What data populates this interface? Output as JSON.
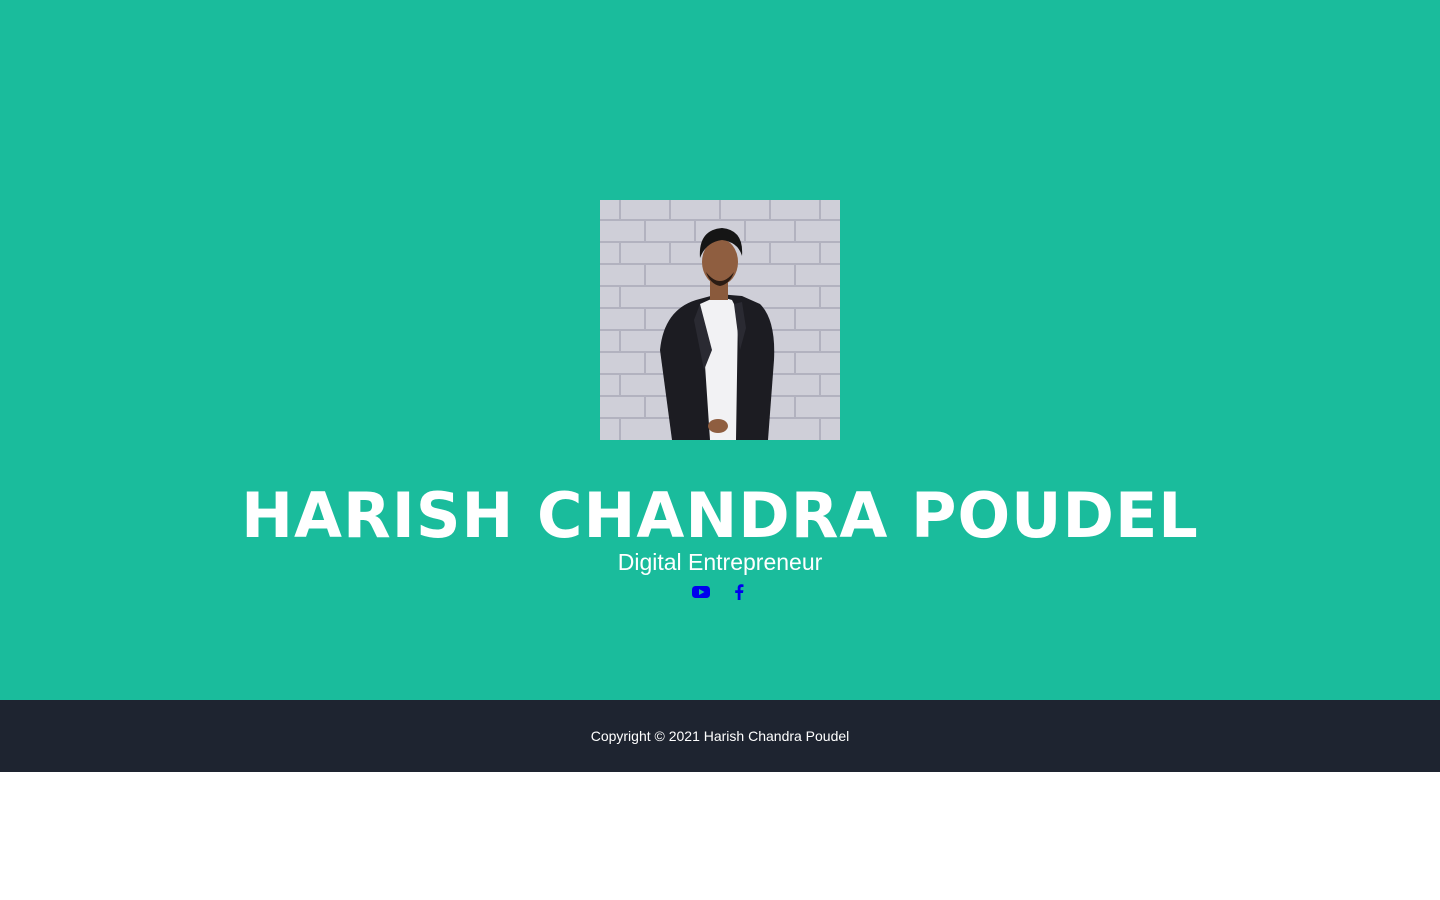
{
  "colors": {
    "hero_background": "#1abc9c",
    "footer_background": "#1e2430",
    "text": "#ffffff",
    "social_icon": "#0000ee"
  },
  "profile": {
    "name": "HARISH CHANDRA POUDEL",
    "title": "Digital Entrepreneur"
  },
  "social_links": [
    {
      "icon": "youtube-icon"
    },
    {
      "icon": "facebook-icon"
    }
  ],
  "footer": {
    "copyright": "Copyright © 2021 Harish Chandra Poudel"
  }
}
